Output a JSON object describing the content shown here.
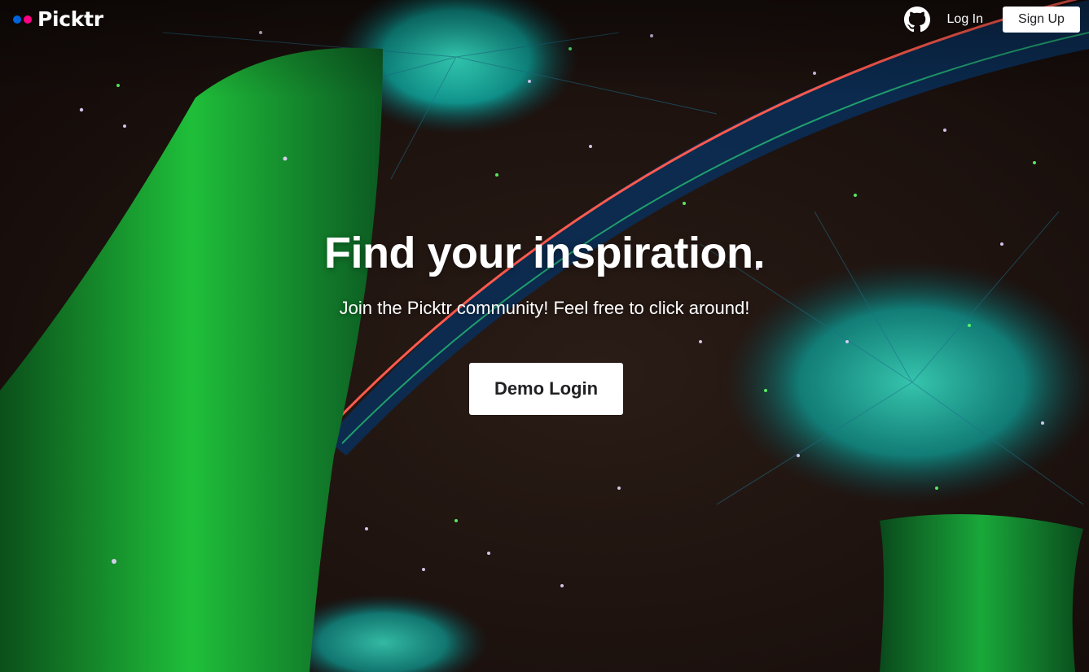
{
  "brand": {
    "name": "Picktr",
    "dot_colors": [
      "#0063dc",
      "#ff0084"
    ]
  },
  "nav": {
    "github_icon": "github-icon",
    "login_label": "Log In",
    "signup_label": "Sign Up"
  },
  "hero": {
    "title": "Find your inspiration.",
    "subtitle": "Join the Picktr community! Feel free to click around!",
    "demo_button_label": "Demo Login",
    "background_image": "night-garden-supertrees"
  },
  "colors": {
    "brand_blue": "#0063dc",
    "brand_pink": "#ff0084",
    "button_bg": "#ffffff",
    "button_text": "#212124"
  }
}
